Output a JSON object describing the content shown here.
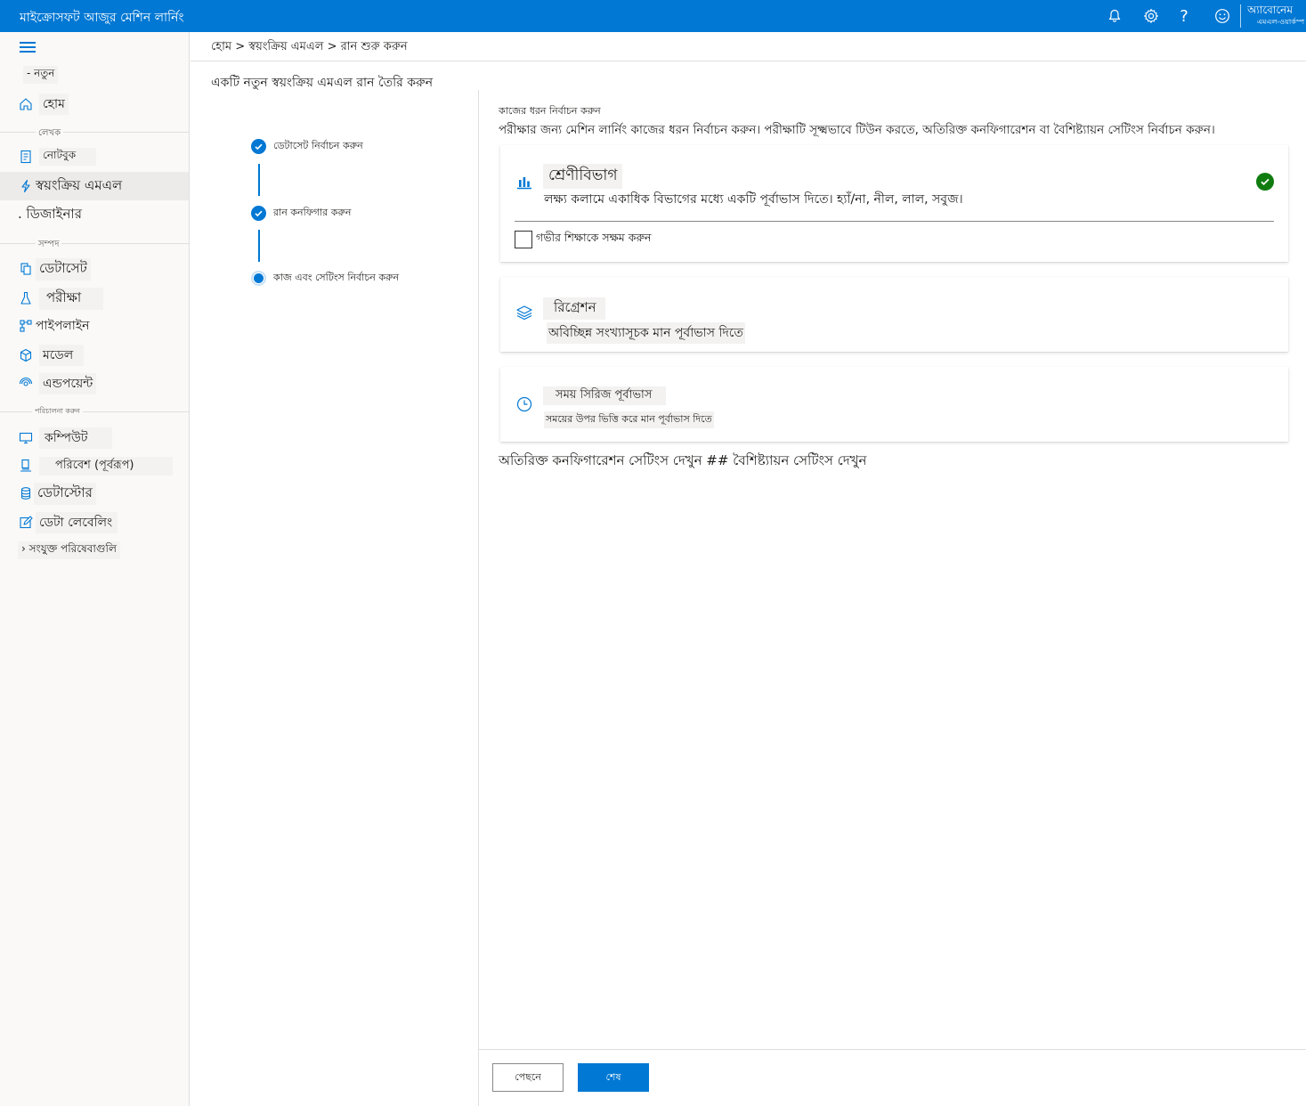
{
  "app": {
    "title": "মাইক্রোসফট আজুর মেশিন লার্নিং",
    "account_name": "অ্যাবোনেম",
    "account_sub": "এমএল-ওয়ার্কস্প"
  },
  "topbar": {
    "icons": [
      "bell-icon",
      "gear-icon",
      "help-icon",
      "smiley-icon"
    ],
    "help_glyph": "?"
  },
  "sidebar": {
    "new_label": "- নতুন",
    "home_label": "হোম",
    "section_author": "লেখক",
    "notebooks_label": "নোটবুক",
    "automl_label": "স্বয়ংক্রিয় এমএল",
    "designer_label": ". ডিজাইনার",
    "section_assets": "সম্পদ",
    "datasets_label": "ডেটাসেট",
    "experiments_label": "পরীক্ষা",
    "pipelines_label": "পাইপলাইন",
    "models_label": "মডেল",
    "endpoints_label": "এন্ডপয়েন্ট",
    "section_manage": "পরিচালনা করুন",
    "compute_label": "কম্পিউট",
    "environments_label": "পরিবেশ (পূর্বরূপ)",
    "datastores_label": "ডেটাস্টোর",
    "labeling_label": "ডেটা লেবেলিং",
    "linked_label": "› সংযুক্ত পরিষেবাগুলি"
  },
  "breadcrumb": "হোম > স্বয়ংক্রিয় এমএল > রান শুরু করুন",
  "page_title": "একটি নতুন স্বয়ংক্রিয় এমএল রান তৈরি করুন",
  "wizard": {
    "steps": [
      {
        "label": "ডেটাসেট নির্বাচন করুন",
        "status": "complete"
      },
      {
        "label": "রান কনফিগার করুন",
        "status": "complete"
      },
      {
        "label": "কাজ এবং সেটিংস নির্বাচন করুন",
        "status": "current"
      }
    ]
  },
  "task": {
    "heading": "কাজের ধরন নির্বাচন করুন",
    "description": "পরীক্ষার জন্য মেশিন লার্নিং কাজের ধরন নির্বাচন করুন। পরীক্ষাটি সূক্ষ্মভাবে টিউন করতে, অতিরিক্ত কনফিগারেশন বা বৈশিষ্ট্যায়ন সেটিংস নির্বাচন করুন।",
    "options": [
      {
        "title": "শ্রেণীবিভাগ",
        "description": "লক্ষ্য কলামে একাধিক বিভাগের মধ্যে একটি পূর্বাভাস দিতে। হ্যাঁ/না, নীল, লাল, সবুজ।",
        "icon": "bar-chart-icon",
        "selected": true
      },
      {
        "title": "রিগ্রেশন",
        "description": "অবিচ্ছিন্ন সংখ্যাসূচক মান পূর্বাভাস দিতে",
        "icon": "layers-icon",
        "selected": false
      },
      {
        "title": "সময় সিরিজ পূর্বাভাস",
        "description": "সময়ের উপর ভিত্তি করে মান পূর্বাভাস দিতে",
        "icon": "clock-icon",
        "selected": false
      }
    ],
    "deep_learning_label": "গভীর শিক্ষাকে সক্ষম করুন",
    "deep_learning_checked": false,
    "more_settings": "অতিরিক্ত কনফিগারেশন সেটিংস দেখুন ## বৈশিষ্ট্যায়ন সেটিংস দেখুন"
  },
  "footer": {
    "back_label": "পেছনে",
    "finish_label": "শেষ"
  },
  "colors": {
    "accent": "#0078d4",
    "success": "#107c10",
    "sidebar_bg": "#faf9f8"
  }
}
